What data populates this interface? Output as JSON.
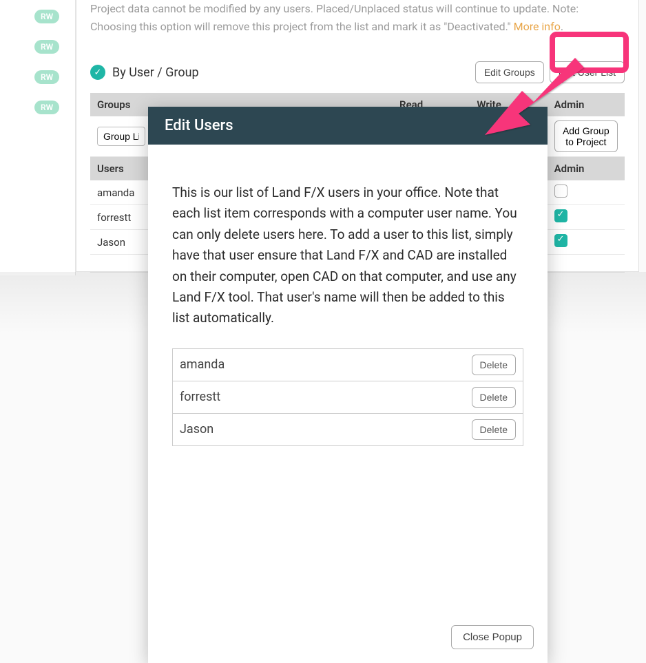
{
  "sidebar": {
    "badge": "RW"
  },
  "note": {
    "line1_part1": "Project data cannot be modified by any users. Placed/Unplaced status will continue to update. Note:",
    "line2_part1": "Choosing this option will remove this project from the list and mark it as \"Deactivated.\" ",
    "more_info": "More info",
    "period": "."
  },
  "section": {
    "title": "By User / Group",
    "edit_groups": "Edit Groups",
    "edit_user_list": "Edit User List"
  },
  "table": {
    "col_groups": "Groups",
    "col_users": "Users",
    "col_read": "Read",
    "col_write": "Write",
    "col_admin": "Admin",
    "group_input_value": "Group List",
    "add_group": "Add Group to Project",
    "users": [
      {
        "name": "amanda",
        "admin_checked": false
      },
      {
        "name": "forrestt",
        "admin_checked": true
      },
      {
        "name": "Jason",
        "admin_checked": true
      }
    ]
  },
  "modal": {
    "title": "Edit Users",
    "intro": "This is our list of Land F/X users in your office. Note that each list item corresponds with a computer user name. You can only delete users here. To add a user to this list, simply have that user ensure that Land F/X and CAD are installed on their computer, open CAD on that computer, and use any Land F/X tool. That user's name will then be added to this list automatically.",
    "delete_label": "Delete",
    "close_label": "Close Popup",
    "users": [
      "amanda",
      "forrestt",
      "Jason"
    ]
  }
}
